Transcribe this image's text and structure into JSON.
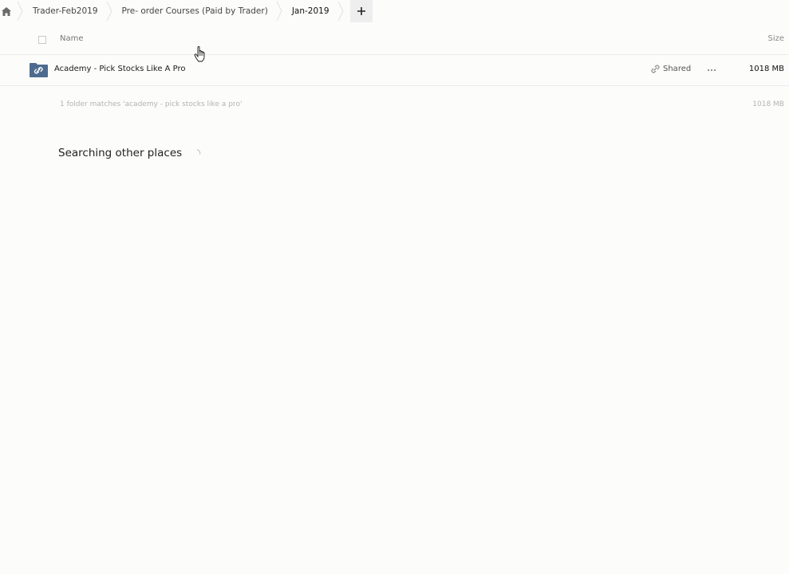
{
  "breadcrumb": {
    "home_icon": "home-icon",
    "items": [
      {
        "label": "Trader-Feb2019"
      },
      {
        "label": "Pre- order Courses (Paid by Trader)"
      },
      {
        "label": "Jan-2019"
      }
    ],
    "add_icon": "plus-icon"
  },
  "header": {
    "name_label": "Name",
    "size_label": "Size"
  },
  "files": [
    {
      "name": "Academy - Pick Stocks Like A Pro",
      "icon": "shared-folder-icon",
      "shared_label": "Shared",
      "size": "1018 MB"
    }
  ],
  "summary": {
    "text": "1 folder matches 'academy - pick stocks like a pro'",
    "size": "1018 MB"
  },
  "search": {
    "status": "Searching other places"
  },
  "colors": {
    "folder": "#4d6b8e",
    "accent_bg": "#eeeeee"
  }
}
